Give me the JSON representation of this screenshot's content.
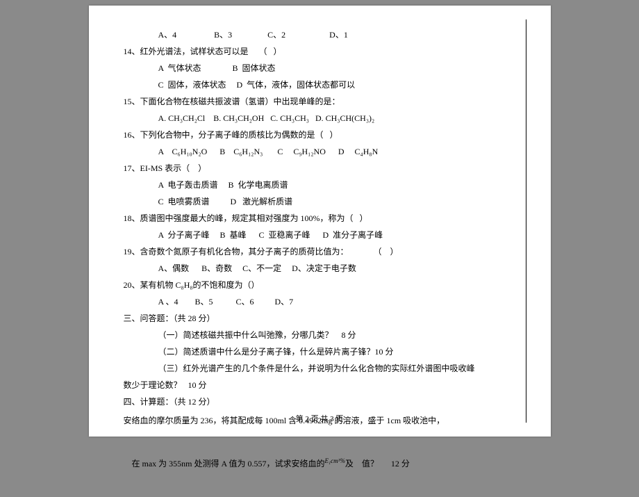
{
  "lines": {
    "l1": "A、4                  B、3                 C、2                     D、1",
    "l2": "14、红外光谱法，试样状态可以是     （   ）",
    "l3": "A  气体状态               B  固体状态",
    "l4": "C  固体，液体状态     D  气体，液体，固体状态都可以",
    "l5": "15、下面化合物在核磁共振波谱（氢谱）中出现单峰的是：",
    "l6": "A. CH₃CH₂Cl    B. CH₃CH₂OH   C. CH₃CH₃   D. CH₃CH(CH₃)₂",
    "l7": "16、下列化合物中，分子离子峰的质核比为偶数的是（   ）",
    "l8": "A    C₆H₁₀N₂O      B    C₆H₁₂N₃       C     C₉H₁₂NO      D     C₄H₈N",
    "l9": "17、EI-MS 表示（    ）",
    "l10": "A  电子轰击质谱     B  化学电离质谱",
    "l11": "C  电喷雾质谱          D   激光解析质谱",
    "l12": "18、质谱图中强度最大的峰，规定其相对强度为 100%，称为（   ）",
    "l13": "A  分子离子峰     B  基峰      C  亚稳离子峰      D  准分子离子峰",
    "l14": "19、含奇数个氮原子有机化合物，其分子离子的质荷比值为：            （    ）",
    "l15": "A、偶数      B、奇数     C、不一定     D、决定于电子数",
    "l16": "20、某有机物 C₈H₈的不饱和度为（）",
    "l17": "A 、4        B、5           C、6          D、7",
    "l18": "三、问答题：（共 28 分）",
    "l19": "（一）简述核磁共振中什么叫弛豫，分哪几类？    8 分",
    "l20": "（二）简述质谱中什么是分子离子锋，什么是碎片离子锋？10 分",
    "l21": "（三）红外光谱产生的几个条件是什么，并说明为什么化合物的实际红外谱图中吸收峰",
    "l22": "数少于理论数？   10 分",
    "l23": "四、计算题：（共 12 分）",
    "l24_a": "安络血的摩尔质量为 236，将其配成每 100ml 含 0.4962mg 的溶液，盛于 1cm 吸收池中，",
    "l25_a": "在 max 为 355nm 处测得 A 值为 0.557，试求安络血的",
    "l25_b": "及    值？      12 分",
    "esym": "E₁cm¹%"
  },
  "footer": "第 2 页  共 3 页"
}
